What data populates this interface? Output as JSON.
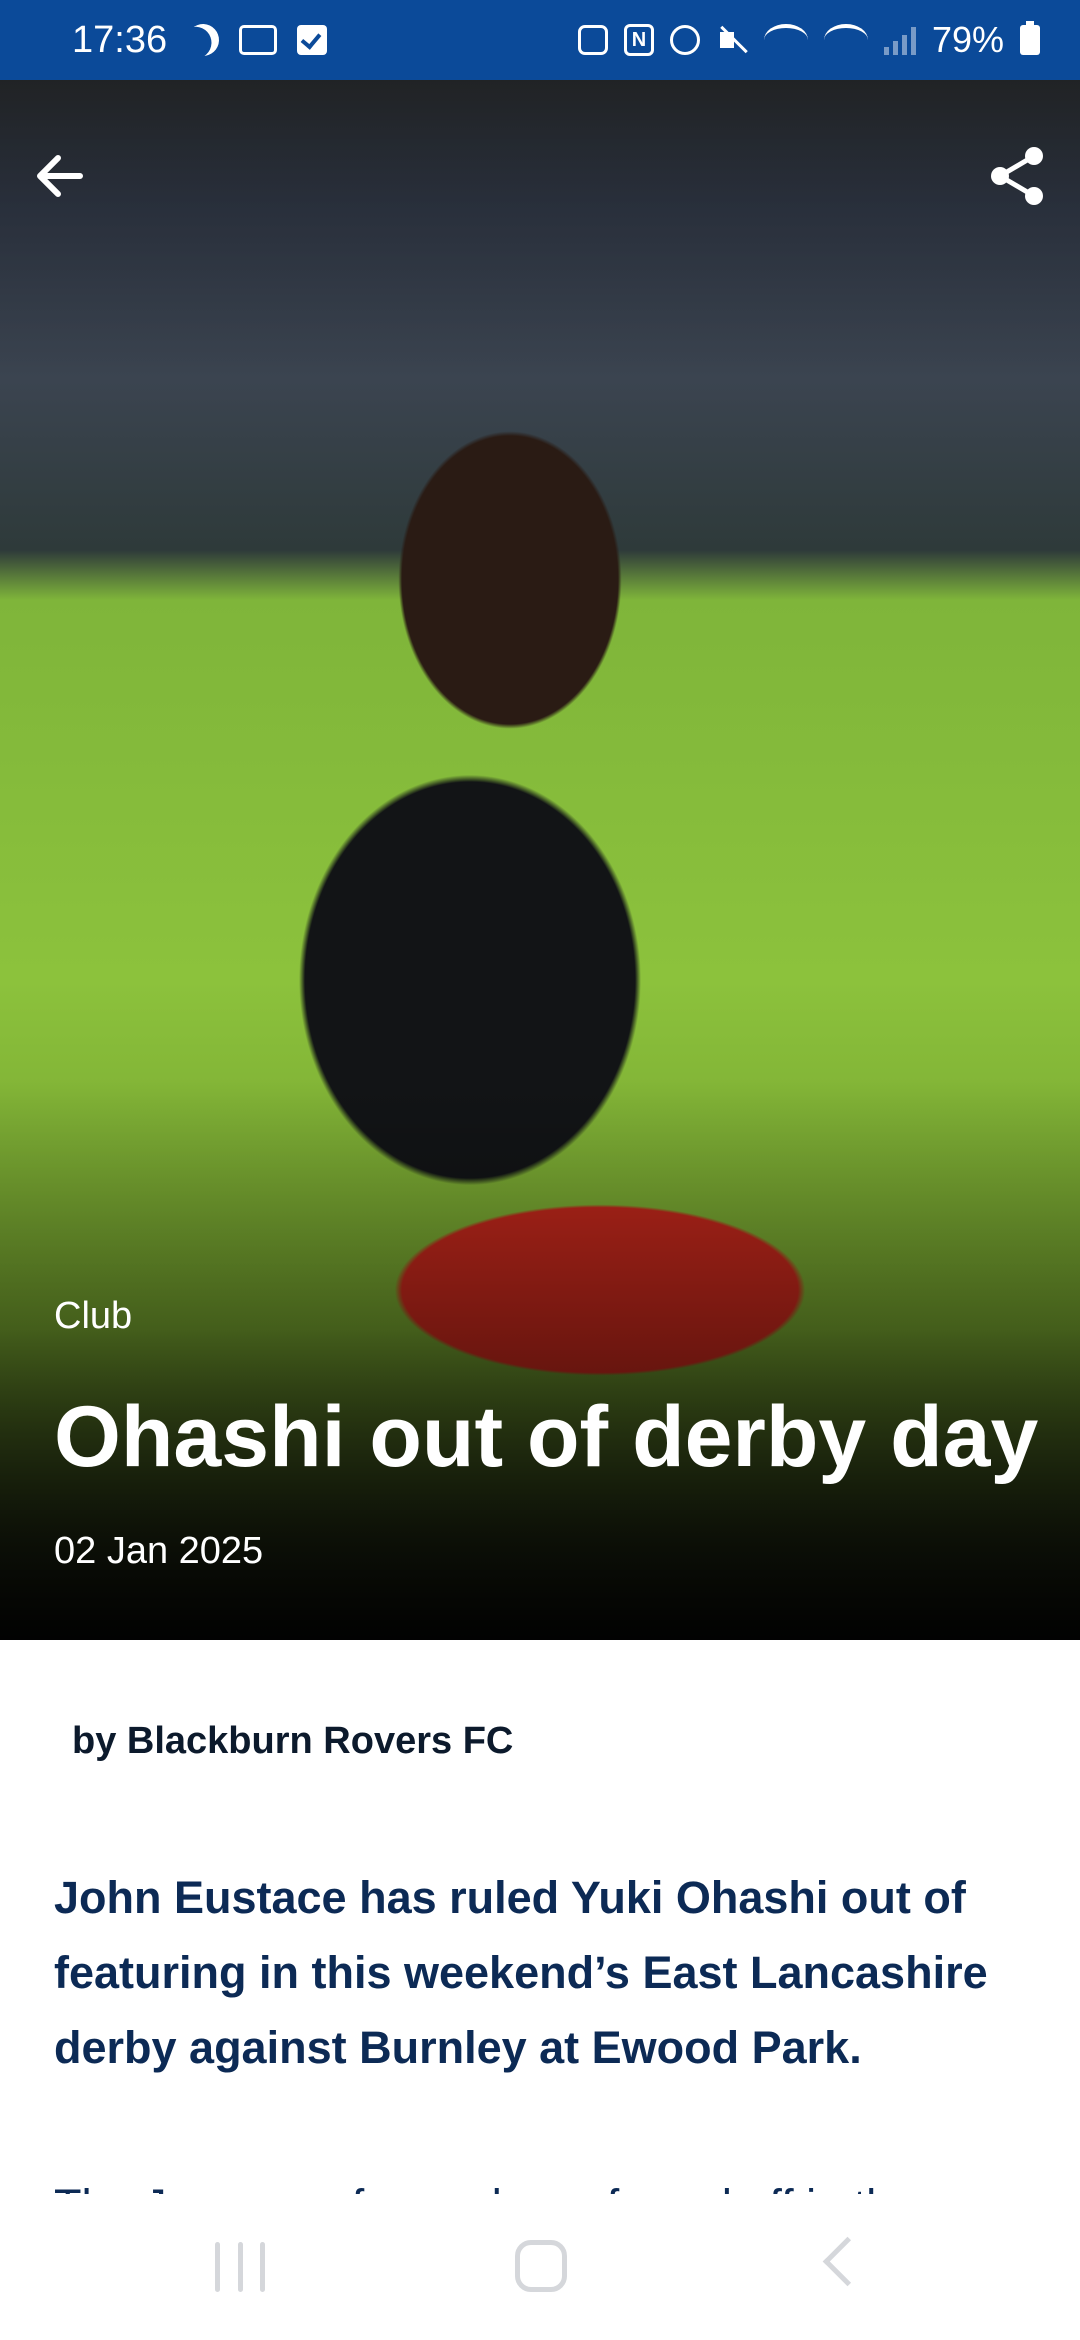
{
  "status_bar": {
    "time": "17:36",
    "battery_percent": "79%",
    "icons": [
      "moon-icon",
      "voicemail-icon",
      "check-icon",
      "recycle-icon",
      "nfc-icon",
      "alarm-icon",
      "mute-icon",
      "wifi-icon",
      "wifi-calling-icon",
      "signal-icon",
      "battery-icon"
    ],
    "background_color": "#0b4a99"
  },
  "header": {
    "back_icon": "arrow-left-icon",
    "share_icon": "share-icon"
  },
  "article": {
    "category": "Club",
    "title": "Ohashi out of derby day",
    "date": "02 Jan 2025",
    "byline": "by Blackburn Rovers FC",
    "lead": "John Eustace has ruled Yuki Ohashi out of featuring in this weekend’s East Lancashire derby against Burnley at Ewood Park.",
    "body_first_line": "The Japanese forward was forced off in the"
  },
  "nav_bar": {
    "icons": [
      "recent-apps-icon",
      "home-icon",
      "back-icon"
    ]
  }
}
